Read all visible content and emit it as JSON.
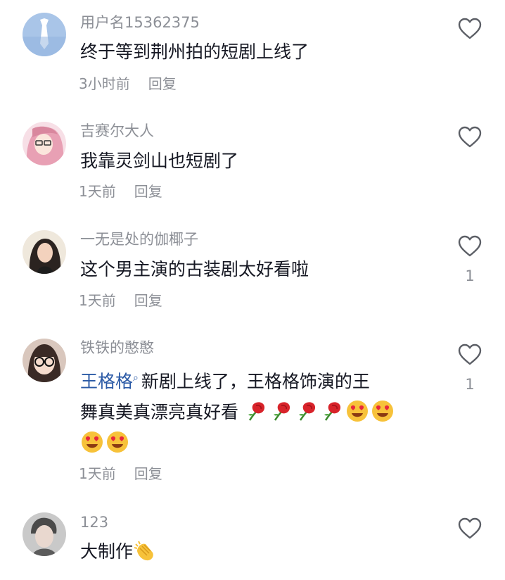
{
  "comments": [
    {
      "username": "用户名15362375",
      "text": "终于等到荆州拍的短剧上线了",
      "time": "3小时前",
      "reply": "回复",
      "likes": "",
      "avatar_icon": "tie-avatar-icon"
    },
    {
      "username": "吉赛尔大人",
      "text": "我靠灵剑山也短剧了",
      "time": "1天前",
      "reply": "回复",
      "likes": "",
      "avatar_icon": "pink-hair-avatar-icon"
    },
    {
      "username": "一无是处的伽椰子",
      "text": "这个男主演的古装剧太好看啦",
      "time": "1天前",
      "reply": "回复",
      "likes": "1",
      "avatar_icon": "girl-avatar-icon"
    },
    {
      "username": "铁铁的憨憨",
      "mention": "王格格",
      "text_line1": "新剧上线了，王格格饰演的王",
      "text_line2": "舞真美真漂亮真好看",
      "time": "1天前",
      "reply": "回复",
      "likes": "1",
      "emojis_line2": [
        "rose",
        "rose",
        "rose",
        "rose",
        "heart-eyes",
        "heart-eyes"
      ],
      "emojis_line3": [
        "heart-eyes",
        "heart-eyes"
      ],
      "avatar_icon": "glasses-avatar-icon"
    },
    {
      "username": "123",
      "text": "大制作",
      "likes": "",
      "emoji": "clap",
      "avatar_icon": "boy-avatar-icon"
    }
  ],
  "colors": {
    "text": "#161823",
    "muted": "#8c8f96",
    "mention": "#2b5aa6"
  }
}
